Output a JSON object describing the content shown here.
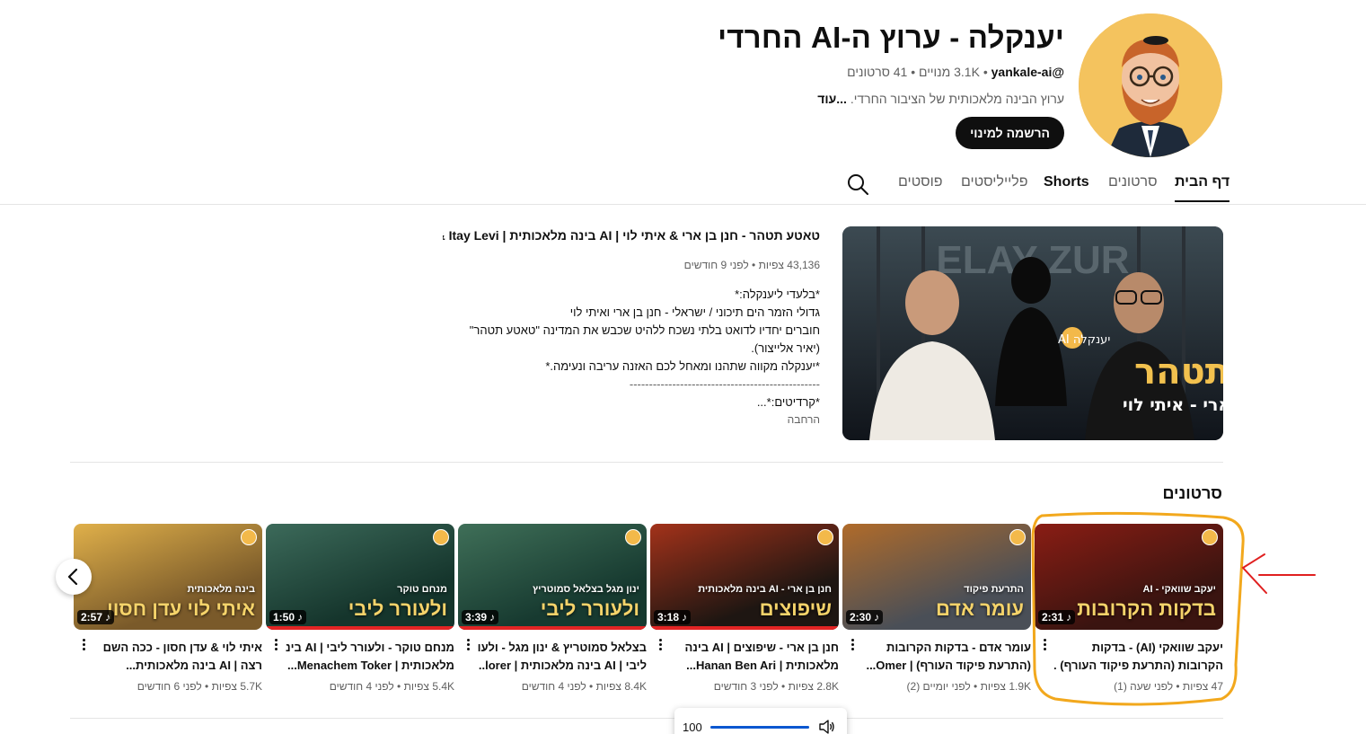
{
  "channel": {
    "title": "יענקלה - ערוץ ה-AI החרדי",
    "handle": "@yankale-ai",
    "subscribers": "3.1K מנויים",
    "videos_count": "41 סרטונים",
    "sep": "‏ • ",
    "description": "ערוץ הבינה מלאכותית של הציבור החרדי.",
    "more": " ...עוד",
    "subscribe_label": "הרשמה למינוי"
  },
  "tabs": {
    "home": "דף הבית",
    "videos": "סרטונים",
    "shorts": "Shorts",
    "playlists": "פלייליסטים",
    "posts": "פוסטים"
  },
  "featured": {
    "title": "טאטע תטהר - חנן בן ארי & איתי לוי | AI בינה מלאכותית | ri & Itay Levi...",
    "stats": "43,136 צפיות • לפני 9 חודשים",
    "desc_lines": [
      "*בלעדי ליענקלה:*",
      "גדולי הזמר הים תיכוני / ישראלי - חנן בן ארי ואיתי לוי",
      "חוברים יחדיו לדואט בלתי נשכח ללהיט שכבש את המדינה \"טאטע תטהר\"",
      "(יאיר אלייצור).",
      "*יענקלה מקווה שתהנו ומאחל לכם האזנה עריבה ונעימה.*",
      "-------------------------------------------------",
      "*קרדיטים:*..."
    ],
    "read_more": "הרחבה",
    "thumb_main_text": "טאטע תטהר",
    "thumb_sub_text": "חנן בן ארי - איתי לוי",
    "thumb_badge": "יענקלה AI",
    "thumb_bg_text": "ELAY ZUR"
  },
  "section_title": "סרטונים",
  "videos": [
    {
      "title_lines": [
        "יעקב שוואקי (AI) - בדקות",
        "הקרובות (התרעת פיקוד העורף) ..."
      ],
      "meta": "47 צפיות • לפני שעה (1)",
      "duration": "2:31",
      "overlay": "בדקות הקרובות",
      "overlay_small": "יעקב שוואקי - AI",
      "bg": "#3a1410",
      "bg2": "#8a1d14",
      "has_progress": false
    },
    {
      "title_lines": [
        "עומר אדם - בדקות הקרובות",
        "(התרעת פיקוד העורף) | Omer..."
      ],
      "meta": "1.9K צפיות • לפני יומיים (2)",
      "duration": "2:30",
      "overlay": "עומר אדם",
      "overlay_small": "התרעת פיקוד",
      "bg": "#4a4f57",
      "bg2": "#b06b2a",
      "has_progress": false
    },
    {
      "title_lines": [
        "חנן בן ארי - שיפוצים | AI בינה",
        "מלאכותית | Hanan Ben Ari..."
      ],
      "meta": "2.8K צפיות • לפני 3 חודשים",
      "duration": "3:18",
      "overlay": "שיפוצים",
      "overlay_small": "חנן בן ארי - AI בינה מלאכותית",
      "bg": "#1e1612",
      "bg2": "#a3321a",
      "has_progress": true
    },
    {
      "title_lines": [
        "בצלאל סמוטריץ & ינון מגל - ולעורר",
        "ליבי | AI בינה מלאכותית | lorer..."
      ],
      "meta": "8.4K צפיות • לפני 4 חודשים",
      "duration": "3:39",
      "overlay": "ולעורר ליבי",
      "overlay_small": "ינון מגל בצלאל סמוטריץ",
      "bg": "#173a30",
      "bg2": "#3f6f58",
      "has_progress": true
    },
    {
      "title_lines": [
        "מנחם טוקר - ולעורר ליבי | AI בינה",
        "מלאכותית | Menachem Toker..."
      ],
      "meta": "5.4K צפיות • לפני 4 חודשים",
      "duration": "1:50",
      "overlay": "ולעורר ליבי",
      "overlay_small": "מנחם טוקר",
      "bg": "#15352c",
      "bg2": "#3c6a5a",
      "has_progress": true
    },
    {
      "title_lines": [
        "איתי לוי & עדן חסון - ככה השם",
        "רצה | AI בינה מלאכותית..."
      ],
      "meta": "5.7K צפיות • לפני 6 חודשים",
      "duration": "2:57",
      "overlay": "איתי לוי עדן חסון",
      "overlay_small": "בינה מלאכותית",
      "bg": "#7a5a2a",
      "bg2": "#e0b04a",
      "has_progress": false
    }
  ],
  "volume": {
    "value": "100",
    "level": 1.0
  },
  "colors": {
    "annotation_circle": "#f2a81d",
    "annotation_arrow": "#e02020",
    "progress": "#e32424"
  }
}
